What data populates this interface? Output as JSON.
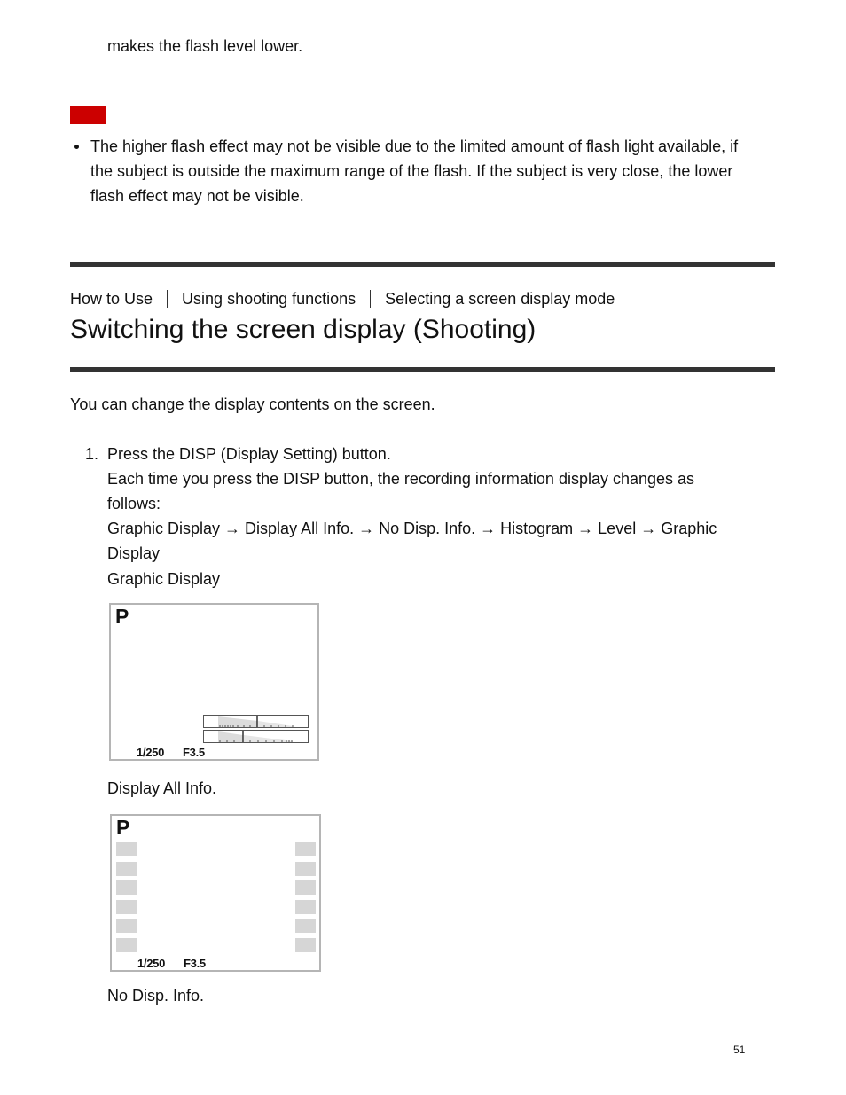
{
  "intro": {
    "continued_text": "makes the flash level lower."
  },
  "note": {
    "marker_color": "#cc0000",
    "bullets": [
      {
        "lines": [
          "The higher flash effect may not be visible due to the limited amount of flash light available, if",
          "the subject is outside the maximum range of the flash. If the subject is very close, the lower",
          "flash effect may not be visible."
        ]
      }
    ]
  },
  "breadcrumb": {
    "items": [
      "How to Use",
      "Using shooting functions",
      "Selecting a screen display mode"
    ]
  },
  "page": {
    "title": "Switching the screen display (Shooting)",
    "description": "You can change the display contents on the screen."
  },
  "steps": [
    {
      "number": "1.",
      "title": "Press the DISP (Display Setting) button.",
      "lines": [
        "Each time you press the DISP button, the recording information display changes as",
        "follows:",
        "Graphic Display → Display All Info. → No Disp. Info. → Histogram → Level → Graphic",
        "Display"
      ]
    }
  ],
  "displays": [
    {
      "caption": "Graphic Display",
      "mode": "P",
      "shutter": "1/250",
      "aperture": "F3.5"
    },
    {
      "caption": "Display All Info.",
      "mode": "P",
      "shutter": "1/250",
      "aperture": "F3.5"
    },
    {
      "caption": "No Disp. Info."
    }
  ],
  "footer": {
    "page_number": "51"
  }
}
